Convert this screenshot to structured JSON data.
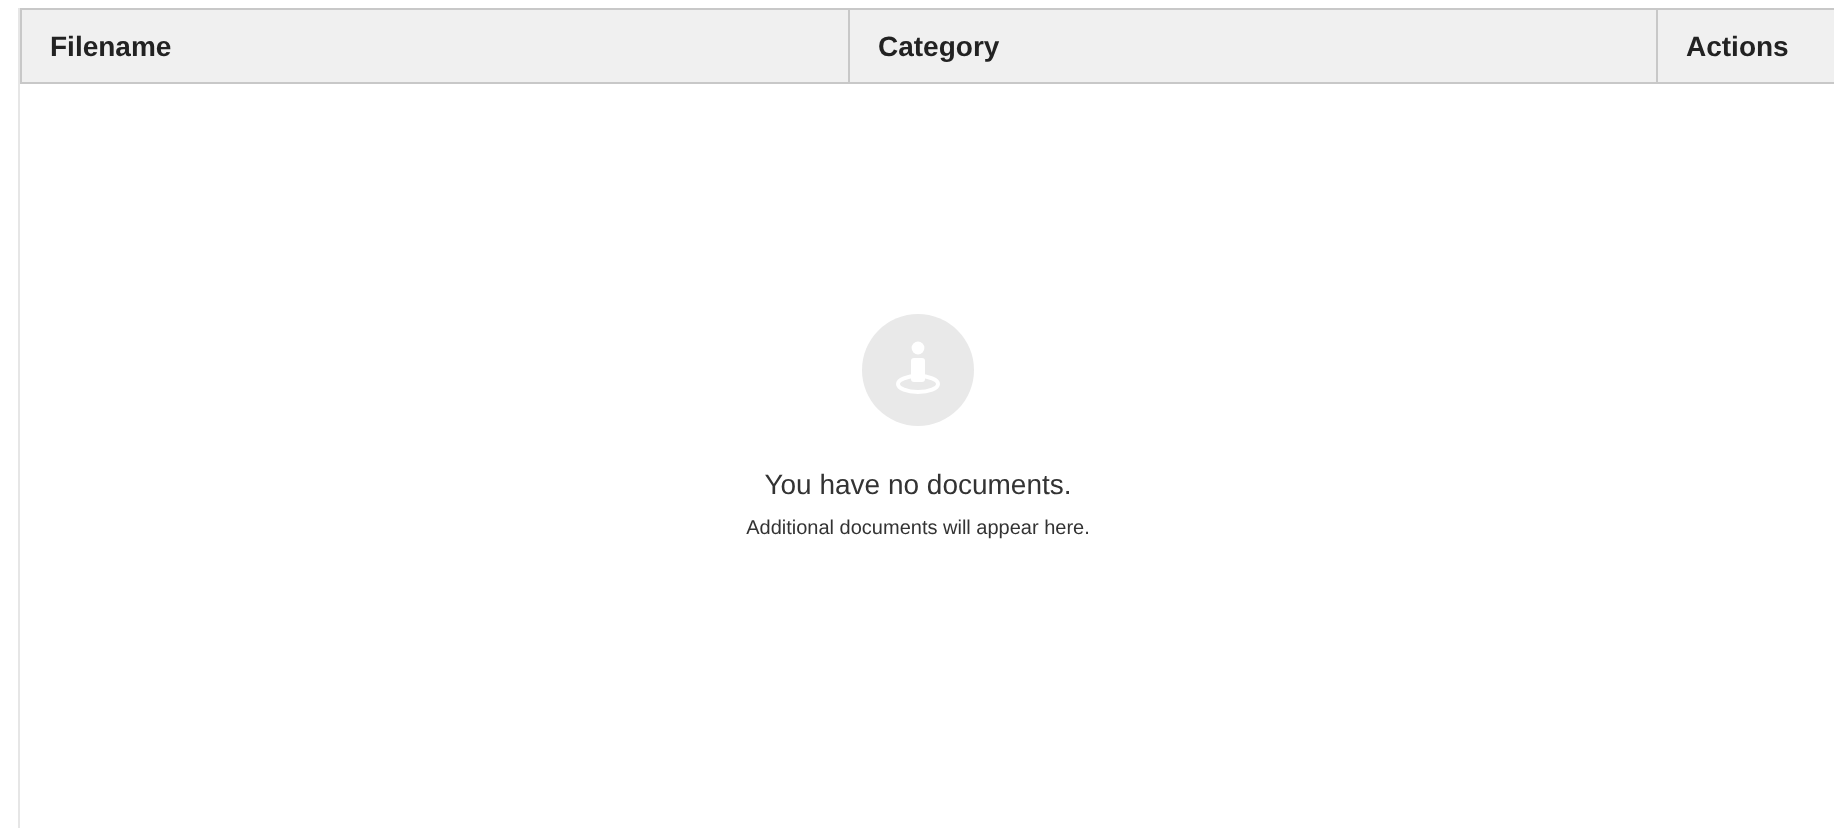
{
  "table": {
    "columns": [
      "Filename",
      "Category",
      "Actions"
    ]
  },
  "empty_state": {
    "title": "You have no documents.",
    "message": "Additional documents will appear here."
  }
}
